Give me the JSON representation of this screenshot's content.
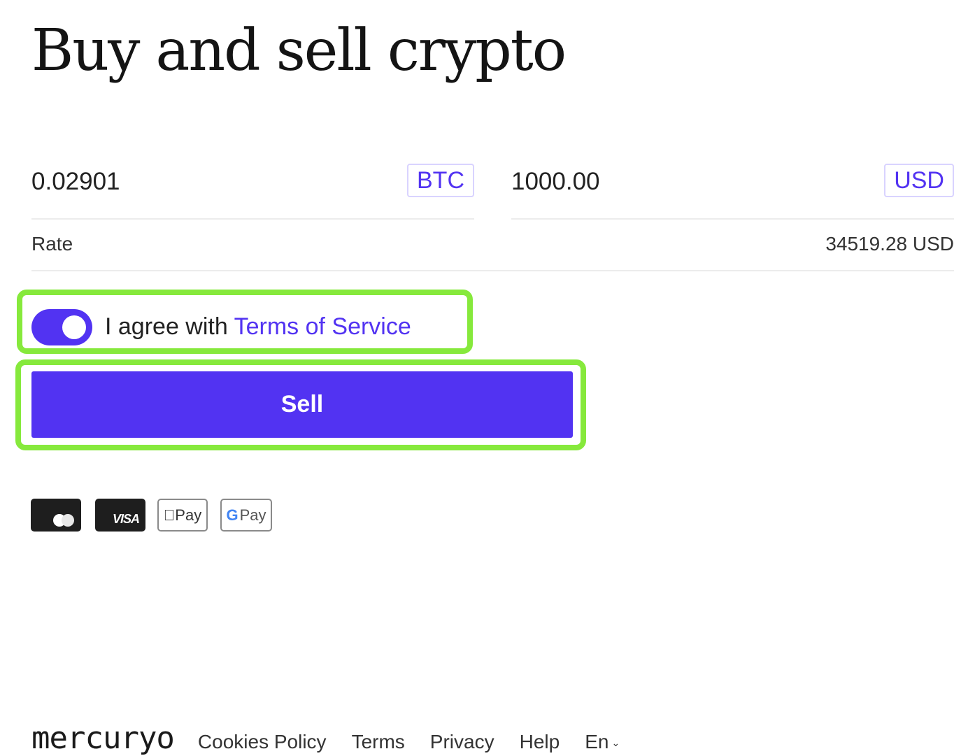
{
  "page": {
    "title": "Buy and sell crypto"
  },
  "exchange": {
    "from": {
      "value": "0.02901",
      "currency": "BTC"
    },
    "to": {
      "value": "1000.00",
      "currency": "USD"
    },
    "rate": {
      "label": "Rate",
      "value": "34519.28 USD"
    }
  },
  "agreement": {
    "checked": true,
    "text": "I agree with ",
    "link_label": "Terms of Service"
  },
  "actions": {
    "sell_label": "Sell"
  },
  "payment_methods": [
    {
      "name": "Mastercard",
      "icon": "mastercard-icon"
    },
    {
      "name": "Visa",
      "icon": "visa-icon",
      "label": "VISA"
    },
    {
      "name": "Apple Pay",
      "icon": "apple-pay-icon",
      "label": "Pay"
    },
    {
      "name": "Google Pay",
      "icon": "google-pay-icon",
      "label": "Pay",
      "g": "G"
    }
  ],
  "footer": {
    "logo": "mercuryo",
    "links": [
      "Cookies Policy",
      "Terms",
      "Privacy",
      "Help"
    ],
    "language": "En"
  },
  "colors": {
    "accent": "#5233f2",
    "highlight": "#86e93c"
  }
}
